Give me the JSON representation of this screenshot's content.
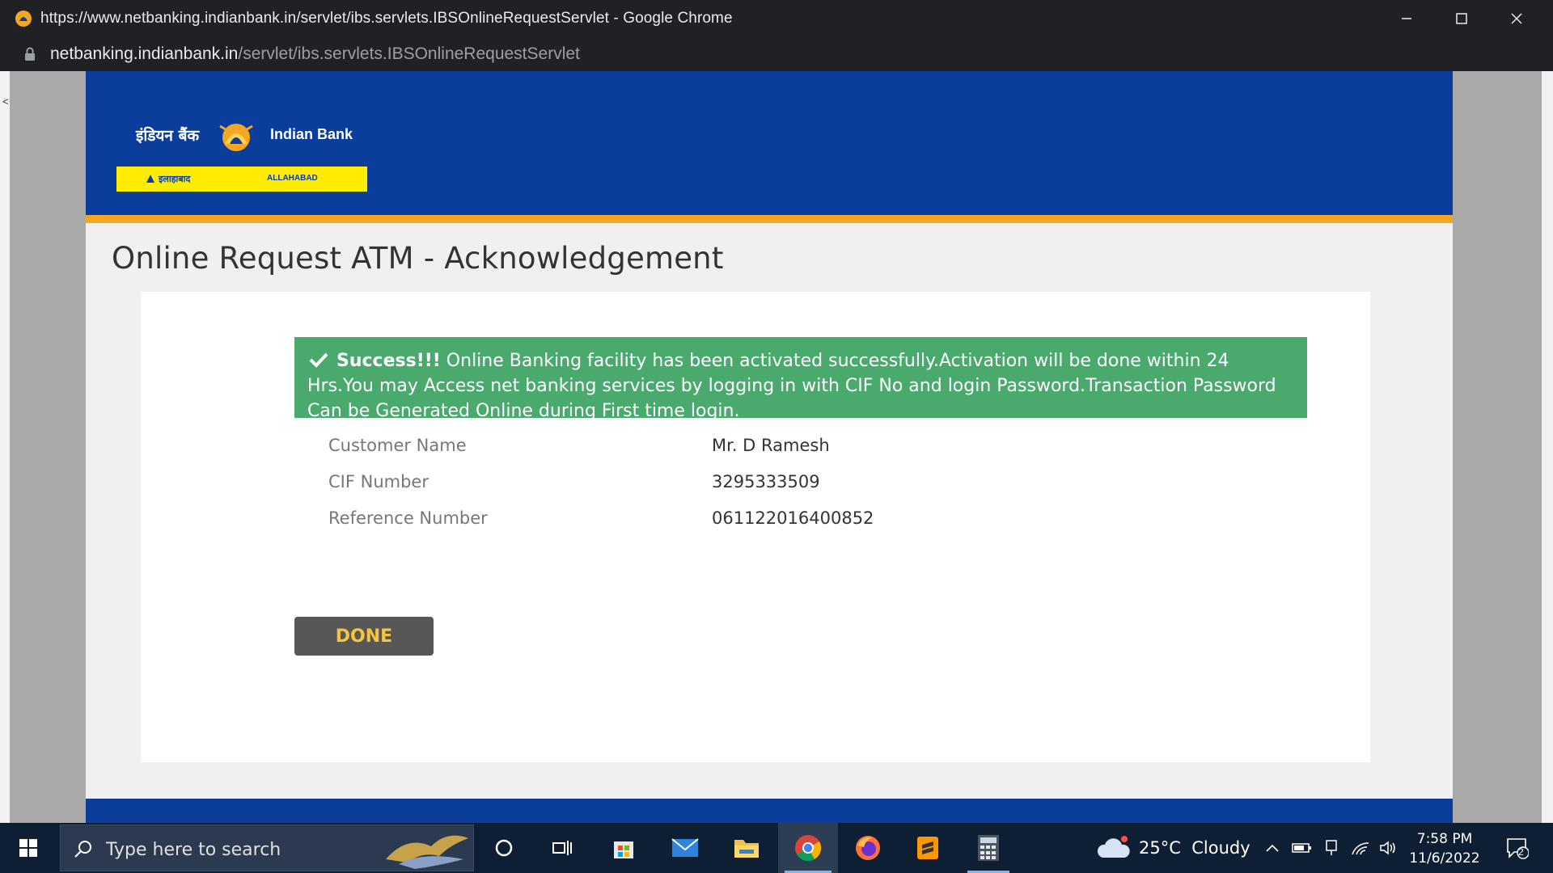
{
  "browser": {
    "window_title": "https://www.netbanking.indianbank.in/servlet/ibs.servlets.IBSOnlineRequestServlet - Google Chrome",
    "url_host": "netbanking.indianbank.in",
    "url_path": "/servlet/ibs.servlets.IBSOnlineRequestServlet",
    "left_gutter_char": "<"
  },
  "logo": {
    "hindi_name": "इंडियन बैंक",
    "english_name": "Indian Bank",
    "strip_hindi": "इलाहाबाद",
    "strip_english": "ALLAHABAD"
  },
  "page": {
    "title": "Online Request ATM - Acknowledgement",
    "alert": {
      "strong": "Success!!!",
      "message": " Online Banking facility has been activated successfully.Activation will be done within 24 Hrs.You may Access net banking services by logging in with CIF No and login Password.Transaction Password Can be Generated Online during First time login."
    },
    "details": [
      {
        "label": "Customer Name",
        "value": "Mr. D Ramesh"
      },
      {
        "label": "CIF Number",
        "value": "3295333509"
      },
      {
        "label": "Reference Number",
        "value": "061122016400852"
      }
    ],
    "done_label": "DONE"
  },
  "taskbar": {
    "search_placeholder": "Type here to search",
    "weather": "25°C  Cloudy",
    "time": "7:58 PM",
    "date": "11/6/2022",
    "notification_count": "2"
  },
  "colors": {
    "header_blue": "#0b3d9c",
    "accent_orange": "#f5a623",
    "success_green": "#4aa96c",
    "done_text": "#f5c542"
  }
}
